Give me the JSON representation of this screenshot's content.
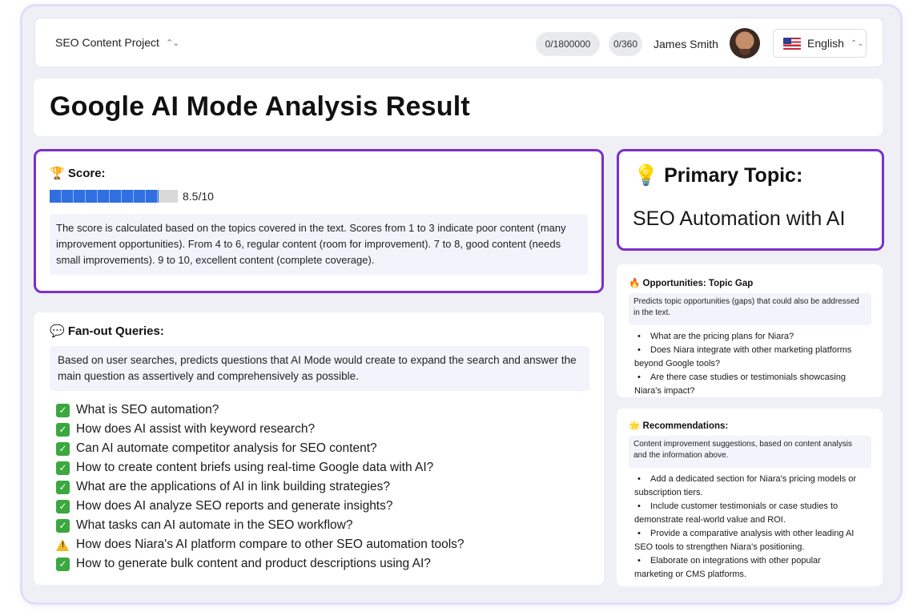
{
  "header": {
    "project": "SEO Content Project",
    "credits": "0/1800000",
    "words": "0/360",
    "user_name": "James Smith",
    "language": "English"
  },
  "page_title": "Google AI Mode Analysis Result",
  "score": {
    "icon": "trophy-icon",
    "heading": "🏆 Score:",
    "value": 8.5,
    "max": 10,
    "label": "8.5/10",
    "description": "The score is calculated based on the topics covered in the text. Scores from 1 to 3 indicate poor content (many improvement opportunities). From 4 to 6, regular content (room for improvement). 7 to 8, good content (needs small improvements). 9 to 10, excellent content (complete coverage)."
  },
  "primary_topic": {
    "heading": "💡 Primary Topic:",
    "value": "SEO Automation with AI"
  },
  "fan_out": {
    "heading": "💬 Fan-out Queries:",
    "description": "Based on user searches, predicts questions that AI Mode would create to expand the search and answer the main question as assertively and comprehensively as possible.",
    "queries": [
      {
        "status": "check",
        "text": "What is SEO automation?"
      },
      {
        "status": "check",
        "text": "How does AI assist with keyword research?"
      },
      {
        "status": "check",
        "text": "Can AI automate competitor analysis for SEO content?"
      },
      {
        "status": "check",
        "text": "How to create content briefs using real-time Google data with AI?"
      },
      {
        "status": "check",
        "text": "What are the applications of AI in link building strategies?"
      },
      {
        "status": "check",
        "text": "How does AI analyze SEO reports and generate insights?"
      },
      {
        "status": "check",
        "text": "What tasks can AI automate in the SEO workflow?"
      },
      {
        "status": "warning",
        "text": "How does Niara's AI platform compare to other SEO automation tools?"
      },
      {
        "status": "check",
        "text": "How to generate bulk content and product descriptions using AI?"
      }
    ]
  },
  "opportunities": {
    "heading": "🔥 Opportunities: Topic Gap",
    "description": "Predicts topic opportunities (gaps) that could also be addressed in the text.",
    "items": [
      "What are the pricing plans for Niara?",
      "Does Niara integrate with other marketing platforms",
      "beyond Google tools?",
      "Are there case studies or testimonials showcasing",
      "Niara's impact?"
    ]
  },
  "recommendations": {
    "heading": "🌟 Recommendations:",
    "description": "Content improvement suggestions, based on content analysis and the information above.",
    "items": [
      "Add a dedicated section for Niara's pricing models or",
      "subscription tiers.",
      "Include customer testimonials or case studies to",
      "demonstrate real-world value and ROI.",
      "Provide a comparative analysis with other leading AI",
      "SEO tools to strengthen Niara's positioning.",
      "Elaborate on integrations with other popular",
      "marketing or CMS platforms."
    ]
  },
  "colors": {
    "accent": "#7a2fc9",
    "bar_fill": "#2f6fe0",
    "check": "#3aa83f",
    "warning": "#f2b81e"
  }
}
